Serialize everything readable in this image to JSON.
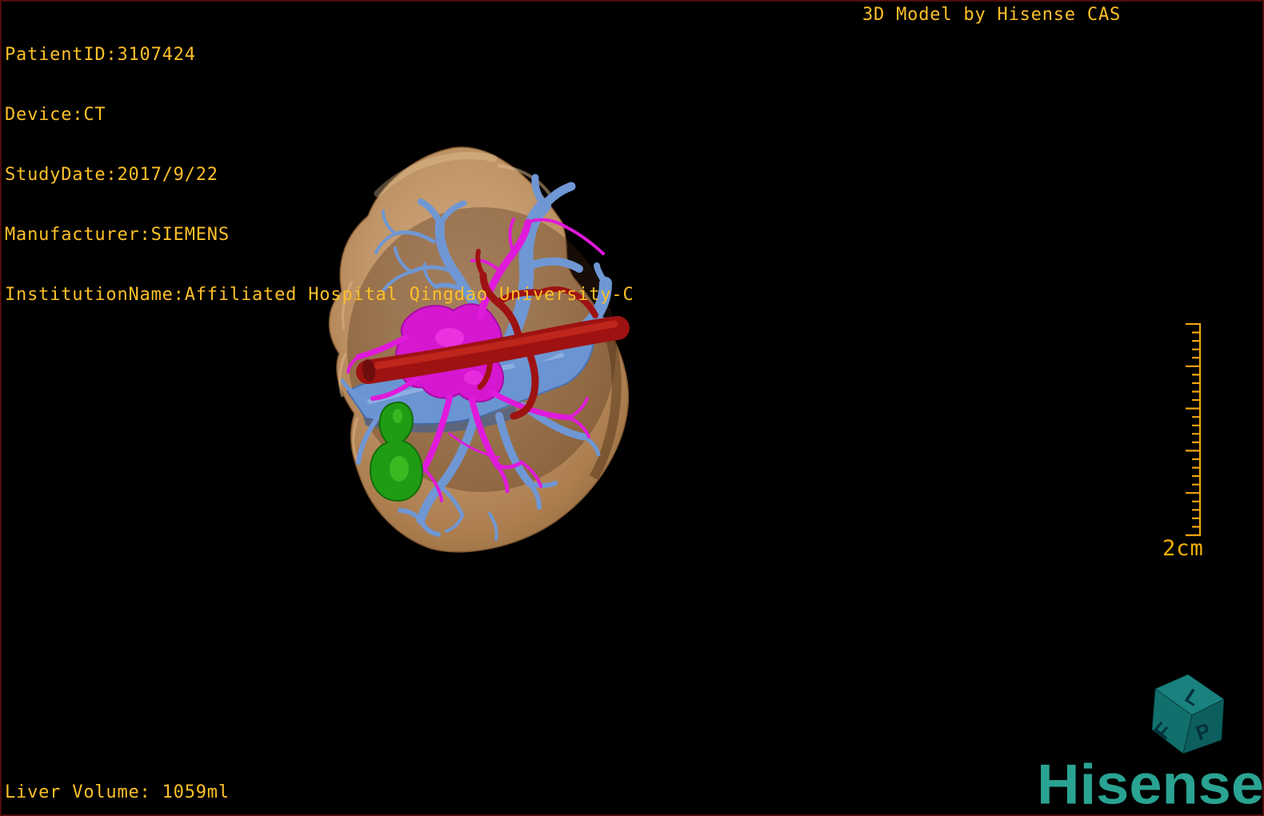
{
  "window": {
    "background": "#000000",
    "border_color": "#4e0d0d",
    "overlay_text_color": "#fdc028"
  },
  "patient_info": {
    "lines": [
      "PatientID:3107424",
      "Device:CT",
      "StudyDate:2017/9/22",
      "Manufacturer:SIEMENS",
      "InstitutionName:Affiliated Hospital Qingdao University-C"
    ]
  },
  "watermark": {
    "text": "3D Model by Hisense CAS"
  },
  "stats": {
    "liver_volume": "Liver Volume: 1059ml"
  },
  "scale_ruler": {
    "label": "2cm",
    "color": "#f0a50a"
  },
  "orientation_cube": {
    "top_letter": "L",
    "left_letter": "F",
    "right_letter": "P",
    "color": "#11706c"
  },
  "branding": {
    "logo_text": "Hisense",
    "logo_color": "#2aa392"
  },
  "model": {
    "structures": [
      {
        "name": "liver",
        "color": "#c2936a"
      },
      {
        "name": "portal-vein",
        "color": "#6f97d4"
      },
      {
        "name": "hepatic-vein-bile-duct",
        "color": "#d617d0"
      },
      {
        "name": "artery-ivc",
        "color": "#9e1212"
      },
      {
        "name": "gallbladder",
        "color": "#1f9c13"
      }
    ]
  }
}
